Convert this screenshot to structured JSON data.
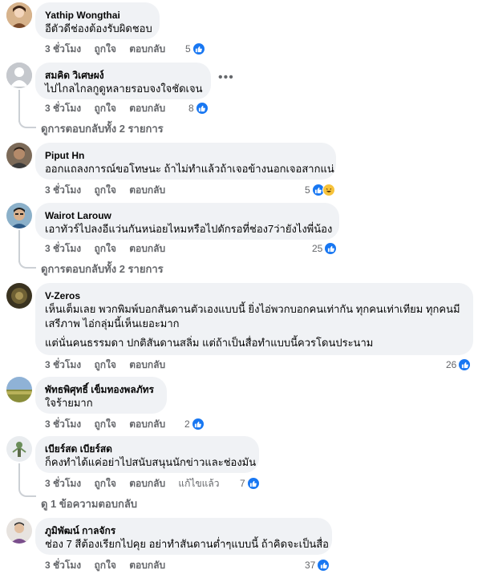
{
  "comments": [
    {
      "name": "Yathip Wongthai",
      "lines": [
        "อีตัวดีช่องต้องรับผิดชอบ"
      ],
      "time": "3 ชั่วโมง",
      "like": "ถูกใจ",
      "reply": "ตอบกลับ",
      "reactions": "5"
    },
    {
      "name": "สมคิด วิเศษผง์",
      "lines": [
        "ไปไกลไกลกูดูหลายรอบจงใจชัดเจน"
      ],
      "time": "3 ชั่วโมง",
      "like": "ถูกใจ",
      "reply": "ตอบกลับ",
      "reactions": "8",
      "more_replies": "ดูการตอบกลับทั้ง 2 รายการ"
    },
    {
      "name": "Piput Hn",
      "lines": [
        "ออกแถลงการณ์ขอโทษนะ ถ้าไม่ทำแล้วถ้าเจอข้างนอกเจอสากแน่"
      ],
      "time": "3 ชั่วโมง",
      "like": "ถูกใจ",
      "reply": "ตอบกลับ",
      "reactions": "5"
    },
    {
      "name": "Wairot Larouw",
      "lines": [
        "เอาทัวร์ไปลงอีแว่นกันหน่อยไหมหรือไปดักรอที่ช่อง7ว่ายังไงพี่น้อง"
      ],
      "time": "3 ชั่วโมง",
      "like": "ถูกใจ",
      "reply": "ตอบกลับ",
      "reactions": "25",
      "more_replies": "ดูการตอบกลับทั้ง 2 รายการ"
    },
    {
      "name": "V-Zeros",
      "lines": [
        "เห็นเต็มเลย พวกพิมพ์บอกสันดานตัวเองแบบนี้ ยิ่งไอ่พวกบอกคนเท่ากัน ทุกคนเท่าเทียม ทุกคนมี",
        "เสรีภาพ ไอ่กลุ่มนี้เห็นเยอะมาก",
        "แต่นั่นคนธรรมดา ปกติสันดานสลิ่ม แต่ถ้าเป็นสื่อทำแบบนี้ควรโดนประนาม"
      ],
      "time": "3 ชั่วโมง",
      "like": "ถูกใจ",
      "reply": "ตอบกลับ",
      "reactions": "26"
    },
    {
      "name": "พัทธพิศุทธิ์ เข็มทองพลภัทร",
      "lines": [
        "ใจร้ายมาก"
      ],
      "time": "3 ชั่วโมง",
      "like": "ถูกใจ",
      "reply": "ตอบกลับ",
      "reactions": "2"
    },
    {
      "name": "เบียร์สด เบียร์สด",
      "lines": [
        "ก็คงทำได้แค่อย่าไปสนับสนุนนักข่าวและช่องมัน"
      ],
      "time": "3 ชั่วโมง",
      "like": "ถูกใจ",
      "reply": "ตอบกลับ",
      "edited": "แก้ไขแล้ว",
      "reactions": "7",
      "more_replies": "ดู 1 ข้อความตอบกลับ"
    },
    {
      "name": "ภูมิพัฒน์ กาลจักร",
      "lines": [
        "ช่อง 7 สีต้องเรียกไปคุย อย่าทำสันดานต่ำๆแบบนี้ ถ้าคิดจะเป็นสื่อ"
      ],
      "time": "3 ชั่วโมง",
      "like": "ถูกใจ",
      "reply": "ตอบกลับ",
      "reactions": "37"
    }
  ],
  "icons": {
    "like": "like-reaction-icon",
    "haha": "haha-reaction-icon",
    "more": "more-options-icon"
  },
  "colors": {
    "like_blue": "#1877f2",
    "bubble_bg": "#f0f2f5",
    "secondary_text": "#65676b"
  }
}
